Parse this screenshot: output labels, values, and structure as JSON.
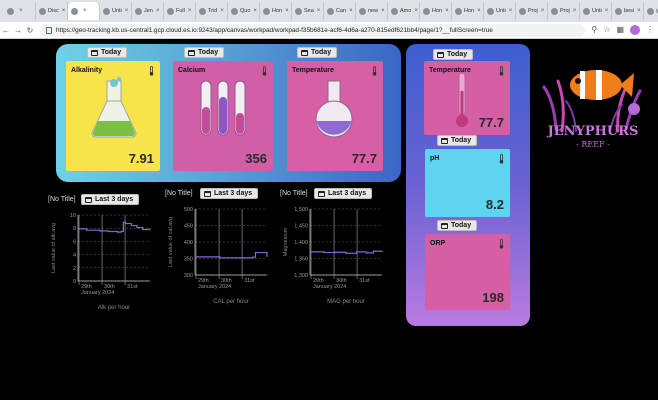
{
  "browser": {
    "tabs": [
      {
        "label": "",
        "active": false
      },
      {
        "label": "Disc",
        "active": false
      },
      {
        "label": "",
        "active": true
      },
      {
        "label": "Unti",
        "active": false
      },
      {
        "label": "Jen",
        "active": false
      },
      {
        "label": "Full",
        "active": false
      },
      {
        "label": "Trid",
        "active": false
      },
      {
        "label": "Quo",
        "active": false
      },
      {
        "label": "Hon",
        "active": false
      },
      {
        "label": "Sea",
        "active": false
      },
      {
        "label": "Can",
        "active": false
      },
      {
        "label": "new",
        "active": false
      },
      {
        "label": "Amo",
        "active": false
      },
      {
        "label": "Hon",
        "active": false
      },
      {
        "label": "Hon",
        "active": false
      },
      {
        "label": "Unti",
        "active": false
      },
      {
        "label": "Proj",
        "active": false
      },
      {
        "label": "Proj",
        "active": false
      },
      {
        "label": "Unti",
        "active": false
      },
      {
        "label": "besi",
        "active": false
      },
      {
        "label": "yell",
        "active": false
      }
    ],
    "url": "https://geo-tracking.kb.us-central1.gcp.cloud.es.io:9243/app/canvas/workpad/workpad-f35b681e-acf6-4d6a-a270-815edf621bb4/page/1?__fullScreen=true"
  },
  "time_chip_today": "Today",
  "time_chip_3days": "Last 3 days",
  "cards_top": [
    {
      "label": "Alkalinity",
      "value": "7.91",
      "bg": "#f7e34a"
    },
    {
      "label": "Calcium",
      "value": "356",
      "bg": "#d15fa6"
    },
    {
      "label": "Temperature",
      "value": "77.7",
      "bg": "#d75fa6"
    }
  ],
  "cards_right": [
    {
      "label": "Temperature",
      "value": "77.7",
      "bg": "#d55fa5"
    },
    {
      "label": "pH",
      "value": "8.2",
      "bg": "#5fd3f2"
    },
    {
      "label": "ORP",
      "value": "198",
      "bg": "#d55fa5"
    }
  ],
  "no_title": "[No Title]",
  "logo_text": {
    "line1": "JENYPHURS",
    "line2": "- REEF -"
  },
  "chart_data": [
    {
      "type": "line",
      "ylabel": "Last value of alk.avg",
      "xlabel": "Alk per hour",
      "ylim": [
        0,
        10
      ],
      "yticks": [
        "0",
        "2",
        "4",
        "6",
        "8",
        "10"
      ],
      "xticks": [
        "29th\nJanuary 2024",
        "30th",
        "31st"
      ],
      "series_color": "#8a64d8",
      "x": [
        0,
        0.12,
        0.2,
        0.3,
        0.42,
        0.55,
        0.6,
        0.63,
        0.66,
        0.74,
        0.82,
        0.9,
        1.0
      ],
      "values": [
        7.9,
        7.7,
        7.7,
        7.6,
        7.5,
        7.4,
        7.5,
        8.9,
        8.7,
        8.4,
        8.1,
        7.8,
        7.9
      ]
    },
    {
      "type": "line",
      "ylabel": "Last value of cal.avg",
      "xlabel": "CAL per hour",
      "ylim": [
        300,
        500
      ],
      "yticks": [
        "300",
        "350",
        "400",
        "450",
        "500"
      ],
      "xticks": [
        "29th\nJanuary 2024",
        "30th",
        "31st"
      ],
      "series_color": "#8a64d8",
      "x": [
        0,
        0.3,
        0.35,
        0.55,
        0.8,
        0.84,
        0.9,
        1.0
      ],
      "values": [
        355,
        355,
        352,
        352,
        354,
        368,
        368,
        356
      ]
    },
    {
      "type": "line",
      "ylabel": "Magnesium",
      "xlabel": "MAG per hour",
      "ylim": [
        1300,
        1500
      ],
      "yticks": [
        "1,300",
        "1,350",
        "1,400",
        "1,450",
        "1,500"
      ],
      "xticks": [
        "29th\nJanuary 2024",
        "30th",
        "31st"
      ],
      "series_color": "#8a64d8",
      "x": [
        0,
        0.2,
        0.35,
        0.5,
        0.65,
        0.78,
        0.88,
        1.0
      ],
      "values": [
        1370,
        1368,
        1369,
        1366,
        1370,
        1367,
        1372,
        1371
      ]
    }
  ]
}
